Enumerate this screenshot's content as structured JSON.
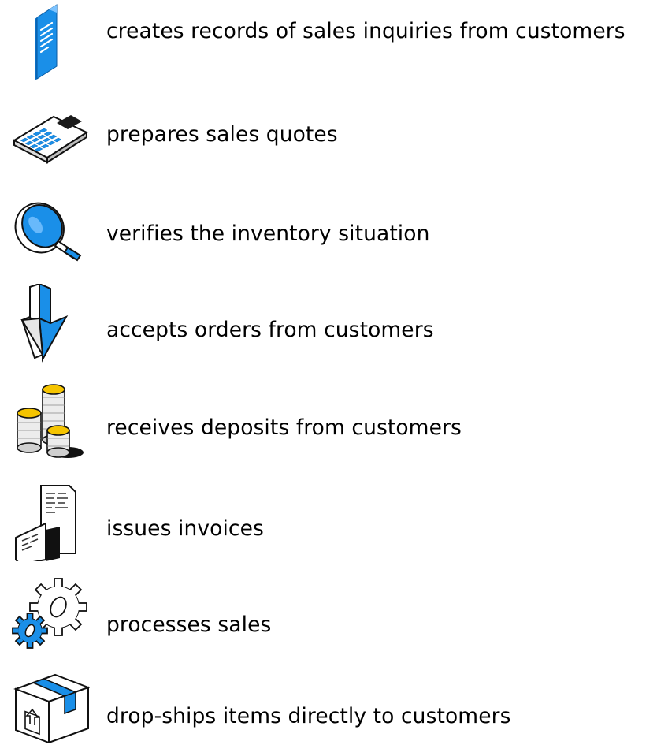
{
  "colors": {
    "accent_blue": "#1a8fe8",
    "accent_blue_dark": "#0b6fc4",
    "gold": "#f5c400",
    "text": "#000000"
  },
  "items": [
    {
      "icon": "document-icon",
      "label": "creates records of sales inquiries from customers"
    },
    {
      "icon": "calculator-icon",
      "label": "prepares sales quotes"
    },
    {
      "icon": "magnifier-icon",
      "label": "verifies the inventory situation"
    },
    {
      "icon": "down-arrow-icon",
      "label": "accepts orders from customers"
    },
    {
      "icon": "coins-icon",
      "label": "receives deposits from customers"
    },
    {
      "icon": "receipt-icon",
      "label": "issues invoices"
    },
    {
      "icon": "gears-icon",
      "label": "processes sales"
    },
    {
      "icon": "package-icon",
      "label": "drop-ships items directly to customers"
    }
  ]
}
